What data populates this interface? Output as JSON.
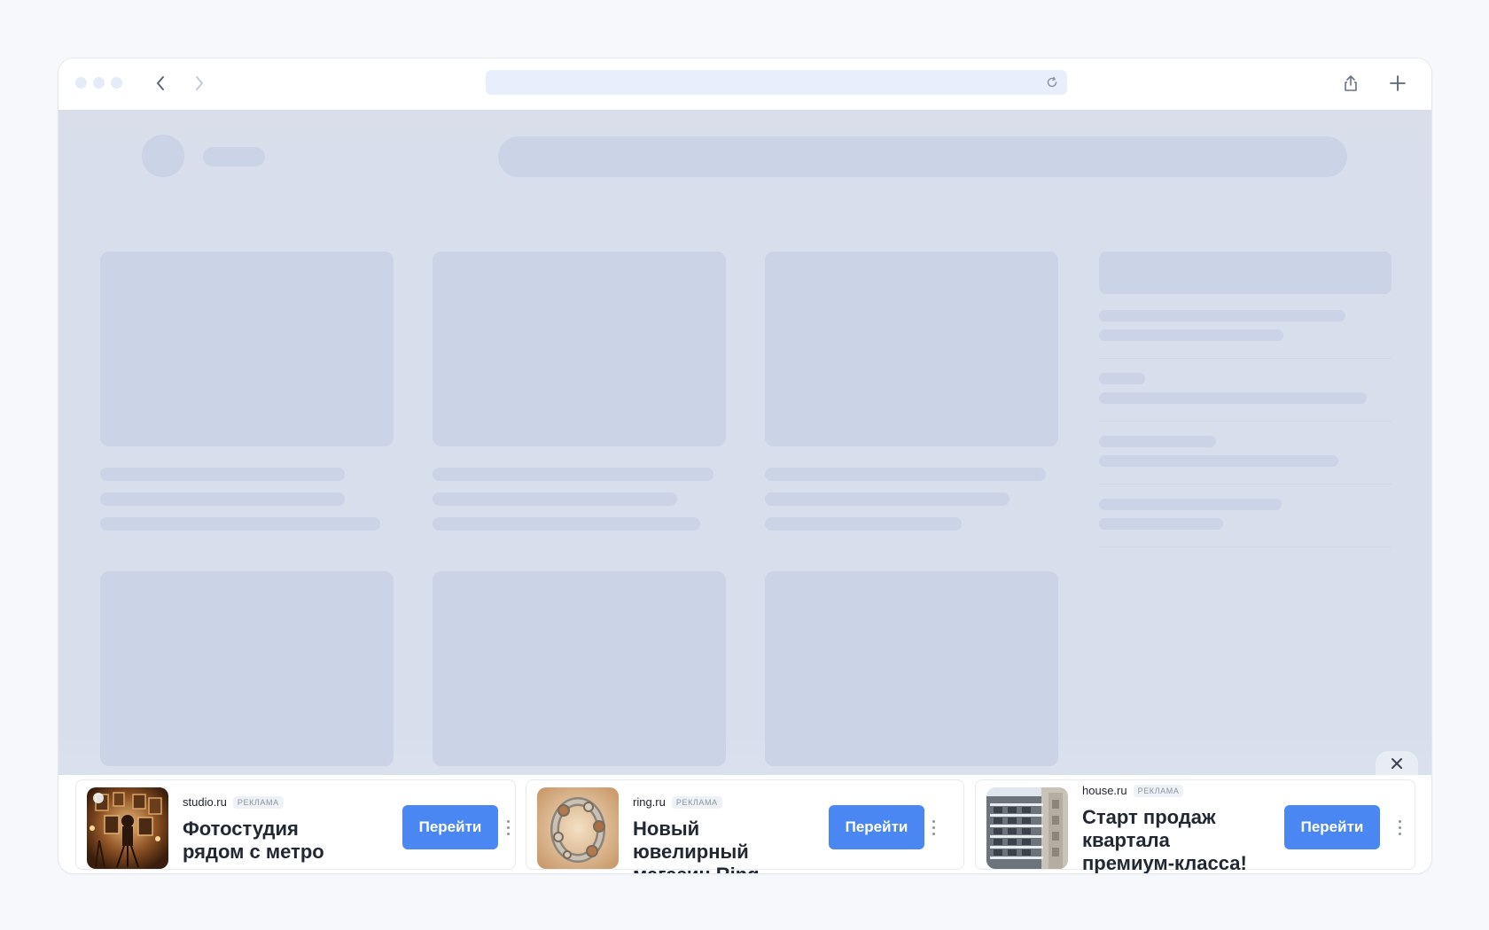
{
  "browser": {
    "toolbar": {
      "back_icon": "chevron-left-icon",
      "forward_icon": "chevron-right-icon",
      "reload_icon": "reload-icon",
      "share_icon": "share-icon",
      "new_tab_icon": "plus-icon"
    }
  },
  "ads": [
    {
      "domain": "studio.ru",
      "badge": "Реклама",
      "title": "Фотостудия рядом с метро",
      "button": "Перейти",
      "image": "photo-studio-image"
    },
    {
      "domain": "ring.ru",
      "badge": "Реклама",
      "title": "Новый ювелирный магазин Ring",
      "button": "Перейти",
      "image": "ring-jewelry-image"
    },
    {
      "domain": "house.ru",
      "badge": "Реклама",
      "title": "Старт продаж квартала премиум-класса!",
      "button": "Перейти",
      "image": "apartment-building-image"
    }
  ],
  "colors": {
    "page_background": "#f7f8fb",
    "skeleton": "#cad4e6",
    "accent_button": "#4a87f2"
  }
}
